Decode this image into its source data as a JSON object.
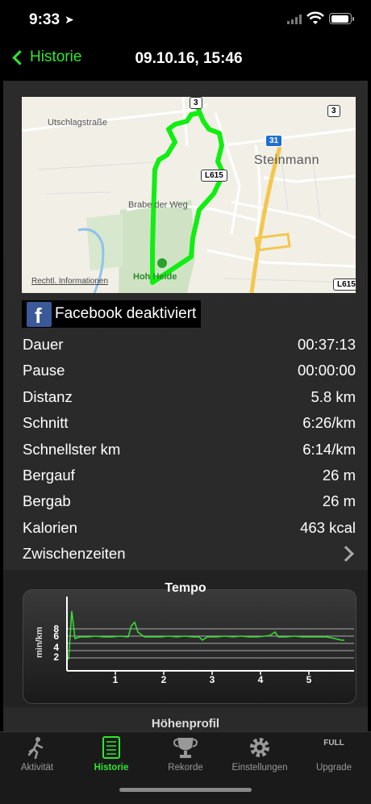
{
  "status": {
    "time": "9:33"
  },
  "nav": {
    "back_label": "Historie",
    "title": "09.10.16, 15:46"
  },
  "map": {
    "labels": {
      "street1": "Utschlagstraße",
      "street2": "Brabe der Weg",
      "town": "Steinmann",
      "area": "Hoh  Heide",
      "legal": "Rechtl. Informationen"
    },
    "shields": {
      "a": "3",
      "b": "3",
      "c": "31",
      "d": "L615",
      "e": "L615"
    }
  },
  "facebook": {
    "label": "Facebook deaktiviert"
  },
  "stats": [
    {
      "label": "Dauer",
      "value": "00:37:13"
    },
    {
      "label": "Pause",
      "value": "00:00:00"
    },
    {
      "label": "Distanz",
      "value": "5.8 km"
    },
    {
      "label": "Schnitt",
      "value": "6:26/km"
    },
    {
      "label": "Schnellster km",
      "value": "6:14/km"
    },
    {
      "label": "Bergauf",
      "value": "26 m"
    },
    {
      "label": "Bergab",
      "value": "26 m"
    },
    {
      "label": "Kalorien",
      "value": "463 kcal"
    }
  ],
  "splits": {
    "label": "Zwischenzeiten"
  },
  "tempo_chart": {
    "title": "Tempo",
    "ylabel": "min/km",
    "y_ticks": [
      "8",
      "6",
      "4",
      "2"
    ],
    "x_ticks": [
      "1",
      "2",
      "3",
      "4",
      "5"
    ],
    "color": "#33dd33"
  },
  "hoehen": {
    "title": "Höhenprofil"
  },
  "tabs": [
    {
      "label": "Aktivität",
      "icon": "runner-icon"
    },
    {
      "label": "Historie",
      "icon": "notebook-icon"
    },
    {
      "label": "Rekorde",
      "icon": "trophy-icon"
    },
    {
      "label": "Einstellungen",
      "icon": "gear-icon"
    },
    {
      "label": "Upgrade",
      "icon_text": "FULL"
    }
  ],
  "accent_color": "#2ee62e"
}
